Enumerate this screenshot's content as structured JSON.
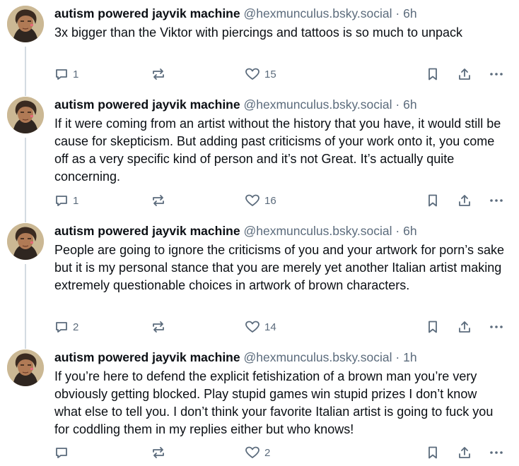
{
  "colors": {
    "text": "#0b0f14",
    "muted": "#5b6b7c",
    "thread_line": "#d4dbe2",
    "background": "#ffffff"
  },
  "posts": [
    {
      "display_name": "autism powered jayvik machine",
      "handle": "@hexmunculus.bsky.social",
      "separator": "·",
      "time": "6h",
      "text": "3x bigger than the Viktor with piercings and tattoos is so much to unpack",
      "replies": "1",
      "reposts": "",
      "likes": "15",
      "icons": [
        "reply-icon",
        "repost-icon",
        "like-icon",
        "bookmark-icon",
        "share-icon",
        "more-icon"
      ]
    },
    {
      "display_name": "autism powered jayvik machine",
      "handle": "@hexmunculus.bsky.social",
      "separator": "·",
      "time": "6h",
      "text": "If it were coming from an artist without the history that you have, it would still be cause for skepticism. But adding past criticisms of your work onto it, you come off as a very specific kind of person and it’s not Great. It’s actually quite concerning.",
      "replies": "1",
      "reposts": "",
      "likes": "16",
      "icons": [
        "reply-icon",
        "repost-icon",
        "like-icon",
        "bookmark-icon",
        "share-icon",
        "more-icon"
      ]
    },
    {
      "display_name": "autism powered jayvik machine",
      "handle": "@hexmunculus.bsky.social",
      "separator": "·",
      "time": "6h",
      "text": "People are going to ignore the criticisms of you and your artwork for porn’s sake but it is my personal stance that you are merely yet another Italian artist making extremely questionable choices in artwork of brown characters.",
      "replies": "2",
      "reposts": "",
      "likes": "14",
      "icons": [
        "reply-icon",
        "repost-icon",
        "like-icon",
        "bookmark-icon",
        "share-icon",
        "more-icon"
      ]
    },
    {
      "display_name": "autism powered jayvik machine",
      "handle": "@hexmunculus.bsky.social",
      "separator": "·",
      "time": "1h",
      "text": "If you’re here to defend the explicit fetishization of a brown man you’re very obviously getting blocked. Play stupid games win stupid prizes I don’t know what else to tell you. I don’t think your favorite Italian artist is going to fuck you for coddling them in my replies either but who knows!",
      "replies": "",
      "reposts": "",
      "likes": "2",
      "icons": [
        "reply-icon",
        "repost-icon",
        "like-icon",
        "bookmark-icon",
        "share-icon",
        "more-icon"
      ]
    }
  ]
}
